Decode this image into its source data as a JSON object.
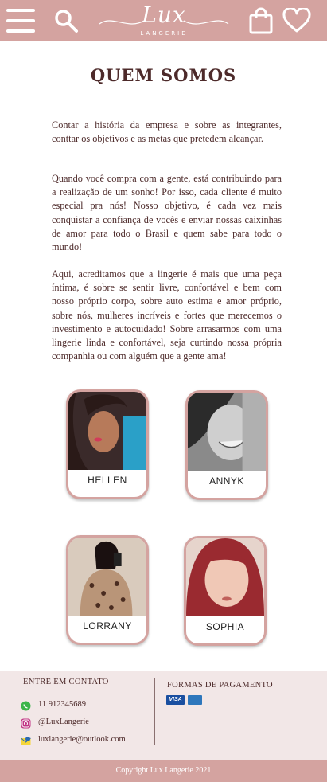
{
  "header": {
    "logo_text": "Lux",
    "logo_subtext": "LANGERIE",
    "icons": [
      "menu-icon",
      "search-icon",
      "shopping-bag-icon",
      "heart-icon"
    ],
    "background_color": "#d4a3a0"
  },
  "main": {
    "title": "QUEM SOMOS",
    "paragraphs": [
      "Contar a história da empresa e sobre as integrantes, conttar os objetivos e as metas que pretedem alcançar.",
      "Quando você compra com a gente, está contribuindo para a realização de um sonho! Por isso, cada cliente é muito especial pra nós! Nosso objetivo, é cada vez mais conquistar a confiança de vocês e enviar nossas caixinhas de amor para todo o Brasil e quem sabe para todo o mundo!",
      "Aqui, acreditamos que a lingerie é mais que uma peça íntima, é sobre se sentir livre, confortável e bem com nosso próprio corpo, sobre auto estima e amor próprio, sobre nós, mulheres incríveis e fortes que merecemos o investimento e autocuidado! Sobre arrasarmos com uma lingerie linda e confortável, seja curtindo nossa própria companhia ou com alguém que a gente ama!"
    ],
    "team": [
      {
        "name": "HELLEN"
      },
      {
        "name": "ANNYK"
      },
      {
        "name": "LORRANY"
      },
      {
        "name": "SOPHIA"
      }
    ]
  },
  "footer": {
    "contact_title": "ENTRE EM CONTATO",
    "contacts": [
      {
        "icon": "whatsapp-icon",
        "text": "11 912345689"
      },
      {
        "icon": "instagram-icon",
        "text": "@LuxLangerie"
      },
      {
        "icon": "email-icon",
        "text": "luxlangerie@outlook.com"
      }
    ],
    "payment_title": "FORMAS DE PAGAMENTO",
    "payment_methods": [
      "VISA",
      "amex-icon"
    ],
    "copyright": "Copyright Lux Langerie 2021"
  }
}
